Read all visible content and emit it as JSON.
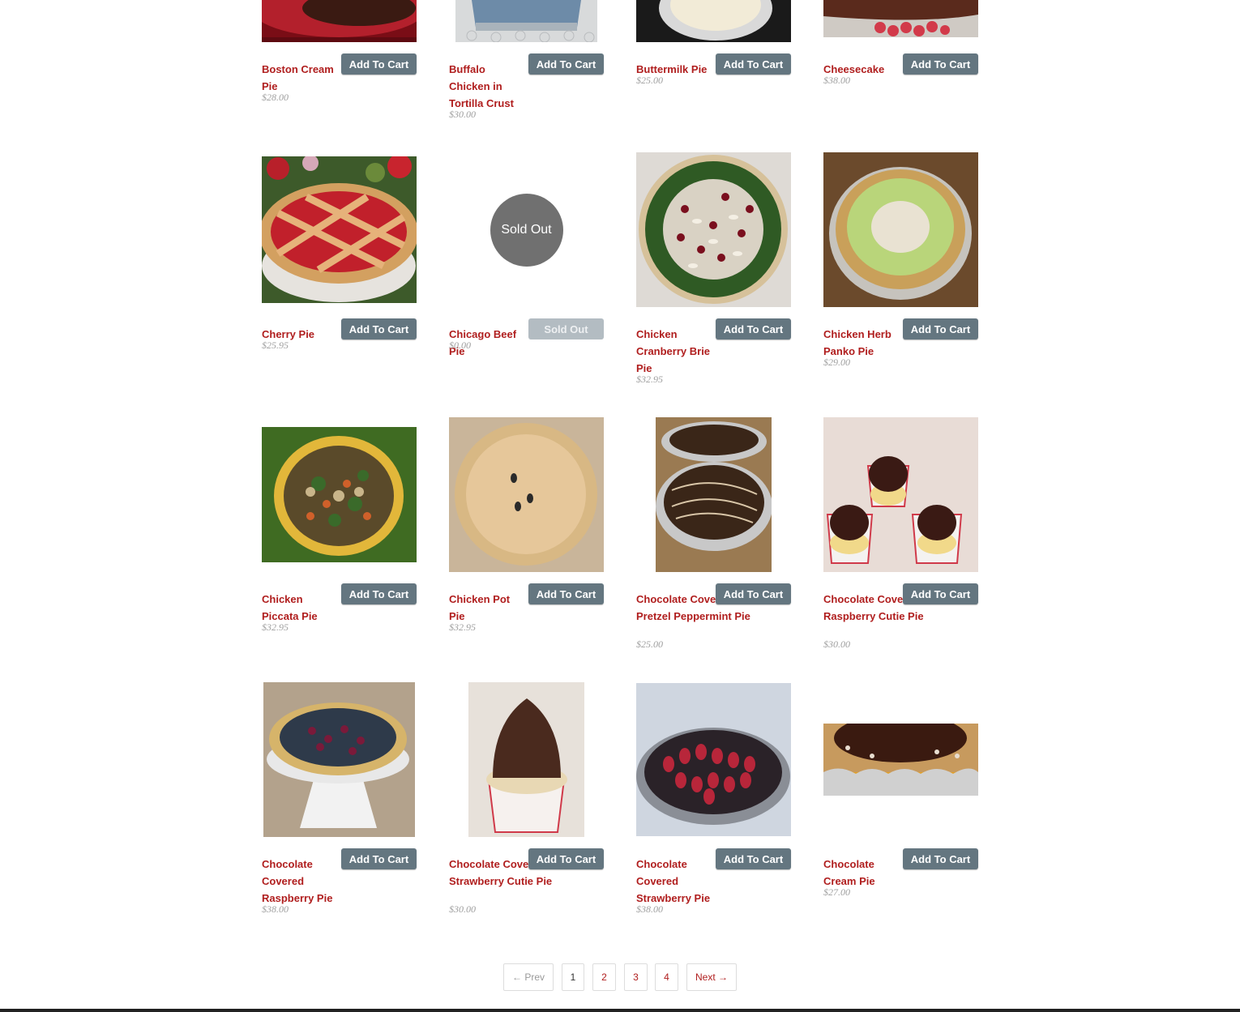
{
  "colors": {
    "title": "#b01e1e",
    "button": "#647680",
    "button_disabled": "#b3bcc2",
    "price": "#a0a0a0"
  },
  "products": [
    {
      "name": "Boston Cream Pie",
      "price": "$28.00",
      "button": "Add To Cart",
      "sold_out": false
    },
    {
      "name": "Buffalo Chicken in Tortilla Crust",
      "price": "$30.00",
      "button": "Add To Cart",
      "sold_out": false
    },
    {
      "name": "Buttermilk Pie",
      "price": "$25.00",
      "button": "Add To Cart",
      "sold_out": false
    },
    {
      "name": "Cheesecake",
      "price": "$38.00",
      "button": "Add To Cart",
      "sold_out": false
    },
    {
      "name": "Cherry Pie",
      "price": "$25.95",
      "button": "Add To Cart",
      "sold_out": false
    },
    {
      "name": "Chicago Beef Pie",
      "price": "$0.00",
      "button": "Sold Out",
      "sold_out": true,
      "badge": "Sold Out"
    },
    {
      "name": "Chicken Cranberry Brie Pie",
      "price": "$32.95",
      "button": "Add To Cart",
      "sold_out": false
    },
    {
      "name": "Chicken Herb Panko Pie",
      "price": "$29.00",
      "button": "Add To Cart",
      "sold_out": false
    },
    {
      "name": "Chicken Piccata Pie",
      "price": "$32.95",
      "button": "Add To Cart",
      "sold_out": false
    },
    {
      "name": "Chicken Pot Pie",
      "price": "$32.95",
      "button": "Add To Cart",
      "sold_out": false
    },
    {
      "name": "Chocolate Covered Pretzel Peppermint Pie",
      "price": "$25.00",
      "button": "Add To Cart",
      "sold_out": false
    },
    {
      "name": "Chocolate Covered Raspberry Cutie Pie",
      "price": "$30.00",
      "button": "Add To Cart",
      "sold_out": false
    },
    {
      "name": "Chocolate Covered Raspberry Pie",
      "price": "$38.00",
      "button": "Add To Cart",
      "sold_out": false
    },
    {
      "name": "Chocolate Covered Strawberry Cutie Pie",
      "price": "$30.00",
      "button": "Add To Cart",
      "sold_out": false
    },
    {
      "name": "Chocolate Covered Strawberry Pie",
      "price": "$38.00",
      "button": "Add To Cart",
      "sold_out": false
    },
    {
      "name": "Chocolate Cream Pie",
      "price": "$27.00",
      "button": "Add To Cart",
      "sold_out": false
    }
  ],
  "pagination": {
    "prev": "← Prev",
    "pages": [
      "1",
      "2",
      "3",
      "4"
    ],
    "current": "1",
    "next": "Next →"
  }
}
